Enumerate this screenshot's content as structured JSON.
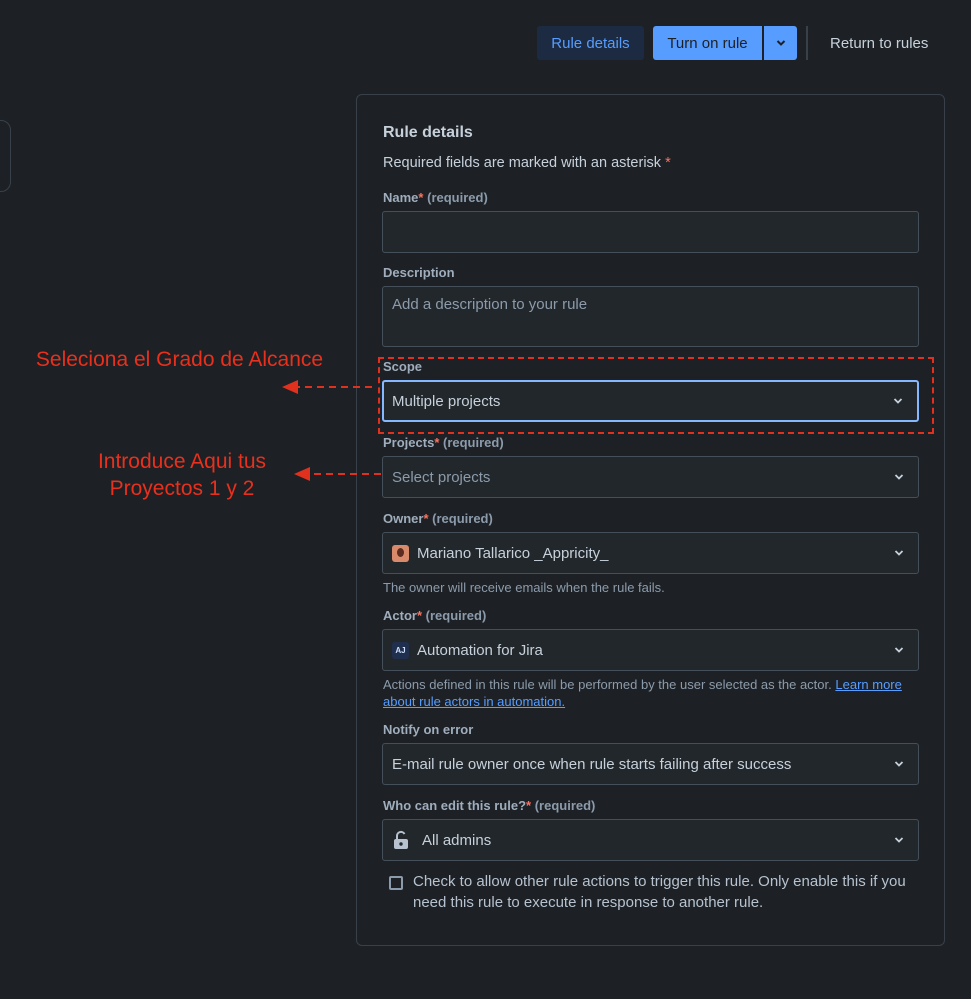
{
  "toolbar": {
    "rule_details": "Rule details",
    "turn_on_rule": "Turn on rule",
    "return_to_rules": "Return to rules"
  },
  "panel": {
    "title": "Rule details",
    "required_note": "Required fields are marked with an asterisk",
    "asterisk": "*"
  },
  "fields": {
    "name": {
      "label": "Name",
      "required": "(required)",
      "value": ""
    },
    "description": {
      "label": "Description",
      "placeholder": "Add a description to your rule"
    },
    "scope": {
      "label": "Scope",
      "value": "Multiple projects"
    },
    "projects": {
      "label": "Projects",
      "required": "(required)",
      "placeholder": "Select projects"
    },
    "owner": {
      "label": "Owner",
      "required": "(required)",
      "value": "Mariano Tallarico _Appricity_",
      "help": "The owner will receive emails when the rule fails."
    },
    "actor": {
      "label": "Actor",
      "required": "(required)",
      "icon_text": "AJ",
      "value": "Automation for Jira",
      "help": "Actions defined in this rule will be performed by the user selected as the actor.",
      "help_link": "Learn more about rule actors in automation."
    },
    "notify": {
      "label": "Notify on error",
      "value": "E-mail rule owner once when rule starts failing after success"
    },
    "who_can_edit": {
      "label": "Who can edit this rule?",
      "required": "(required)",
      "value": "All admins"
    }
  },
  "checkbox": {
    "checked": false,
    "label": "Check to allow other rule actions to trigger this rule. Only enable this if you need this rule to execute in response to another rule."
  },
  "annotations": {
    "scope_note": "Seleciona el Grado de Alcance",
    "projects_note_line1": "Introduce Aqui tus",
    "projects_note_line2": "Proyectos 1 y 2"
  },
  "colors": {
    "background": "#1d2125",
    "accent": "#579dff",
    "annotation_red": "#e8301c",
    "required_star": "#f87462"
  },
  "icons": [
    "chevron-down-icon",
    "avatar",
    "automation-for-jira-icon",
    "unlock-icon"
  ]
}
